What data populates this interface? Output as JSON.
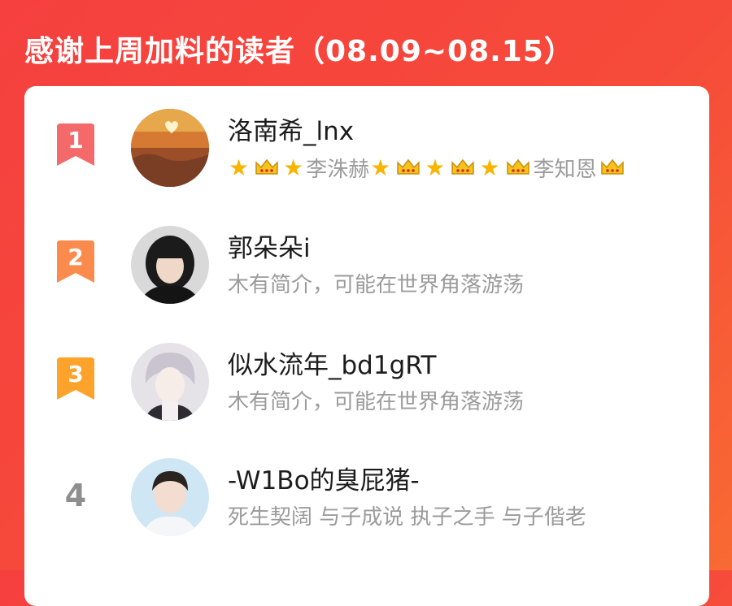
{
  "header": {
    "title": "感谢上周加料的读者（08.09~08.15）"
  },
  "readers": [
    {
      "rank": "1",
      "name": "洛南希_lnx",
      "bio_segments": [
        {
          "type": "star",
          "text": "★"
        },
        {
          "type": "crown"
        },
        {
          "type": "star",
          "text": "★"
        },
        {
          "type": "text",
          "text": "李洙赫"
        },
        {
          "type": "star",
          "text": "★"
        },
        {
          "type": "crown"
        },
        {
          "type": "star",
          "text": "★"
        },
        {
          "type": "crown"
        },
        {
          "type": "star",
          "text": "★"
        },
        {
          "type": "crown"
        },
        {
          "type": "text",
          "text": "李知恩"
        },
        {
          "type": "crown"
        }
      ]
    },
    {
      "rank": "2",
      "name": "郭朵朵i",
      "bio": "木有简介，可能在世界角落游荡"
    },
    {
      "rank": "3",
      "name": "似水流年_bd1gRT",
      "bio": "木有简介，可能在世界角落游荡"
    },
    {
      "rank": "4",
      "name": "-W1Bo的臭屁猪-",
      "bio": "死生契阔 与子成说 执子之手 与子偕老"
    }
  ],
  "colors": {
    "rank1": "#f46a6a",
    "rank2": "#fb8a4d",
    "rank3": "#fda22a",
    "star": "#f7b500",
    "crown": "#f7c21a"
  }
}
